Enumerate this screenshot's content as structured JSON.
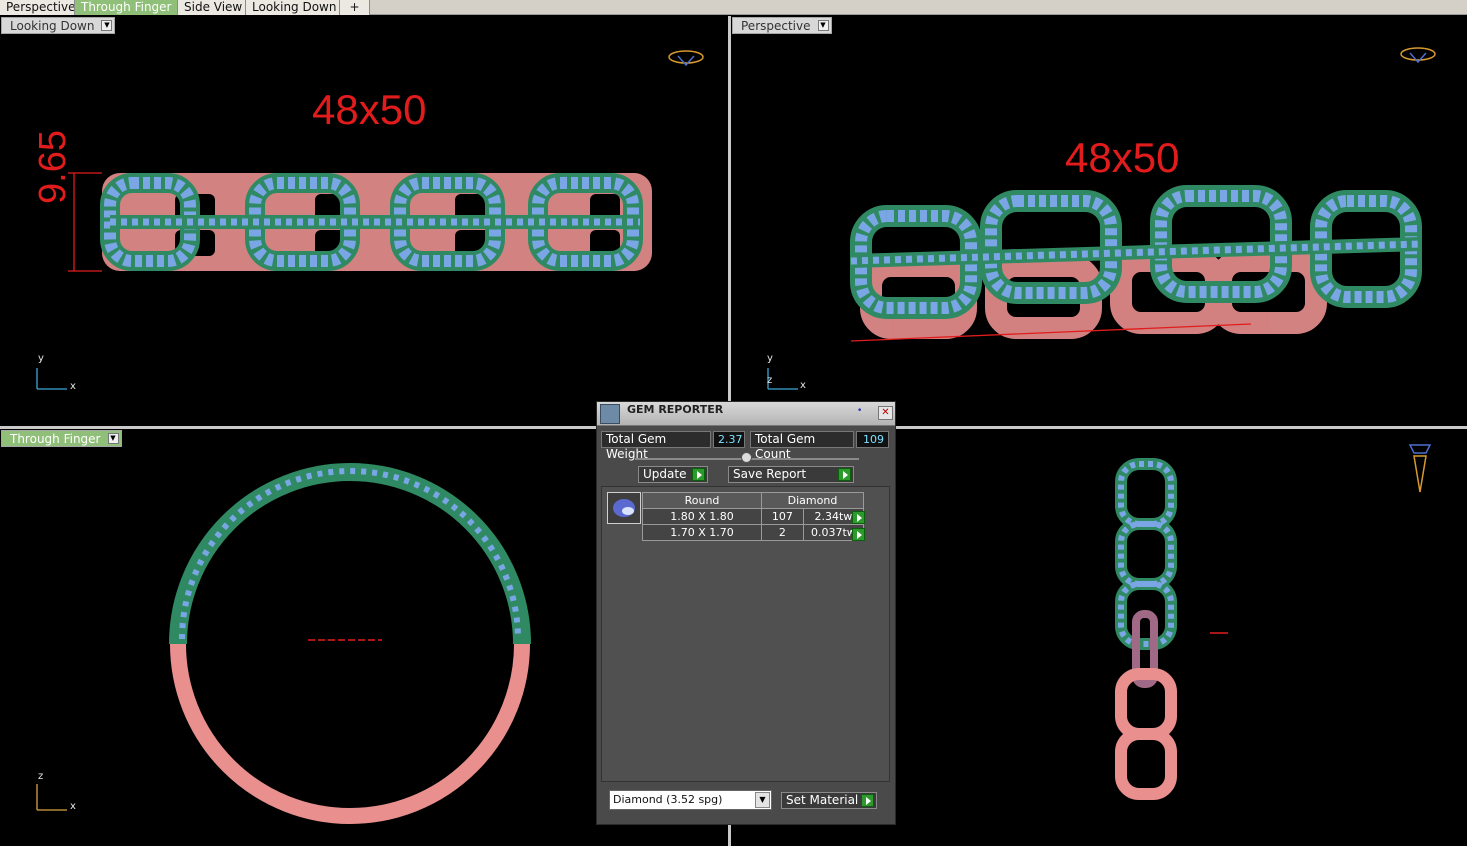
{
  "tabs": [
    {
      "label": "Perspective",
      "active": false
    },
    {
      "label": "Through Finger",
      "active": true
    },
    {
      "label": "Side View",
      "active": false
    },
    {
      "label": "Looking Down",
      "active": false
    },
    {
      "label": "+",
      "active": false
    }
  ],
  "viewports": {
    "top_left": {
      "label": "Looking Down",
      "size_text": "48x50",
      "dim_text": "9.65",
      "axis_v": "y",
      "axis_h": "x"
    },
    "top_right": {
      "label": "Perspective",
      "size_text": "48x50",
      "axis_v": "y",
      "axis_d": "z",
      "axis_h": "x"
    },
    "bottom_left": {
      "label": "Through Finger",
      "axis_v": "z",
      "axis_h": "x"
    },
    "bottom_right": {
      "label": ""
    }
  },
  "gem_reporter": {
    "title": "GEM REPORTER",
    "total_weight_label": "Total Gem Weight",
    "total_weight_value": "2.37",
    "total_count_label": "Total Gem Count",
    "total_count_value": "109",
    "update_label": "Update",
    "save_report_label": "Save Report",
    "table": {
      "headers": [
        "Round",
        "Diamond"
      ],
      "rows": [
        {
          "size": "1.80 X 1.80",
          "count": "107",
          "weight": "2.34tw"
        },
        {
          "size": "1.70 X 1.70",
          "count": "2",
          "weight": "0.037tw"
        }
      ]
    },
    "material_select": "Diamond     (3.52 spg)",
    "set_material_label": "Set Material"
  },
  "colors": {
    "gold": "#2f8a63",
    "gem": "#7aa6e6",
    "rose": "#e9908e",
    "dimension": "#e21c1c",
    "accent_green": "#8fbf78"
  }
}
